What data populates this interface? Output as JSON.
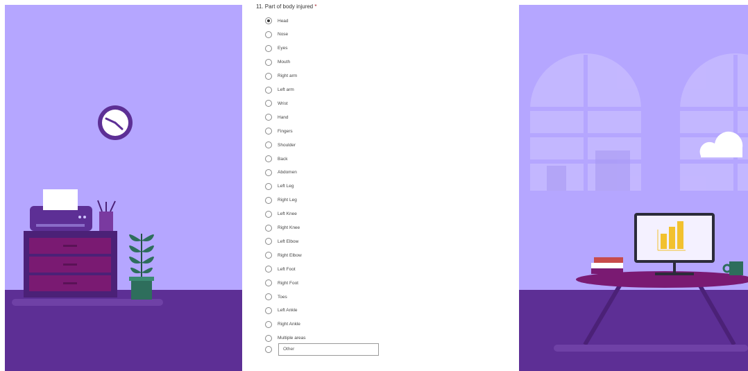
{
  "question": {
    "title": "11. Part of body injured",
    "required_marker": "*",
    "options": [
      {
        "label": "Head",
        "checked": true
      },
      {
        "label": "Nose",
        "checked": false
      },
      {
        "label": "Eyes",
        "checked": false
      },
      {
        "label": "Mouth",
        "checked": false
      },
      {
        "label": "Right arm",
        "checked": false
      },
      {
        "label": "Left arm",
        "checked": false
      },
      {
        "label": "Wrist",
        "checked": false
      },
      {
        "label": "Hand",
        "checked": false
      },
      {
        "label": "Fingers",
        "checked": false
      },
      {
        "label": "Shoulder",
        "checked": false
      },
      {
        "label": "Back",
        "checked": false
      },
      {
        "label": "Abdomen",
        "checked": false
      },
      {
        "label": "Left Leg",
        "checked": false
      },
      {
        "label": "Right Leg",
        "checked": false
      },
      {
        "label": "Left Knee",
        "checked": false
      },
      {
        "label": "Right Knee",
        "checked": false
      },
      {
        "label": "Left Elbow",
        "checked": false
      },
      {
        "label": "Right Elbow",
        "checked": false
      },
      {
        "label": "Left Foot",
        "checked": false
      },
      {
        "label": "Right Foot",
        "checked": false
      },
      {
        "label": "Toes",
        "checked": false
      },
      {
        "label": "Left Ankle",
        "checked": false
      },
      {
        "label": "Right Ankle",
        "checked": false
      },
      {
        "label": "Multiple areas",
        "checked": false
      }
    ],
    "other_placeholder": "Other"
  },
  "colors": {
    "background": "#b5a6ff",
    "floor": "#5d2f95",
    "accent_plum": "#7a1a72",
    "plant_green": "#2e6e5c",
    "chart_gold": "#f2c12e",
    "required": "#a4262c"
  }
}
